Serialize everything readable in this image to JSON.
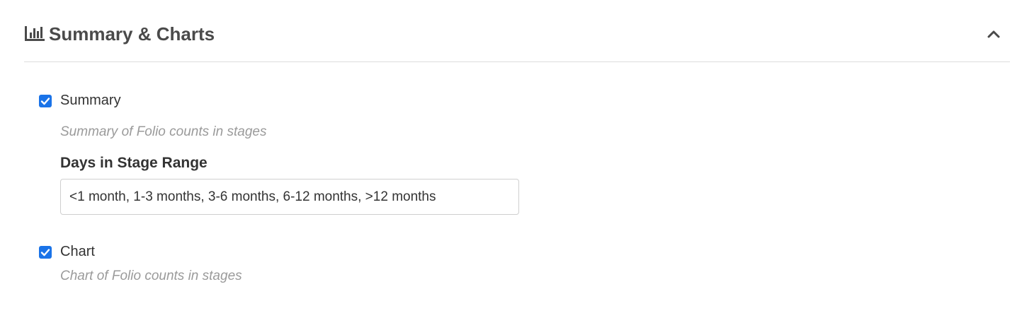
{
  "section": {
    "title": "Summary & Charts",
    "icon": "bar-chart-icon",
    "collapse_icon": "chevron-up-icon"
  },
  "options": {
    "summary": {
      "label": "Summary",
      "checked": true,
      "description": "Summary of Folio counts in stages"
    },
    "days_range": {
      "label": "Days in Stage Range",
      "value": "<1 month, 1-3 months, 3-6 months, 6-12 months, >12 months"
    },
    "chart": {
      "label": "Chart",
      "checked": true,
      "description": "Chart of Folio counts in stages"
    }
  },
  "colors": {
    "checkbox": "#1a73e8",
    "title": "#4a4a4a",
    "description": "#9a9a9a"
  }
}
